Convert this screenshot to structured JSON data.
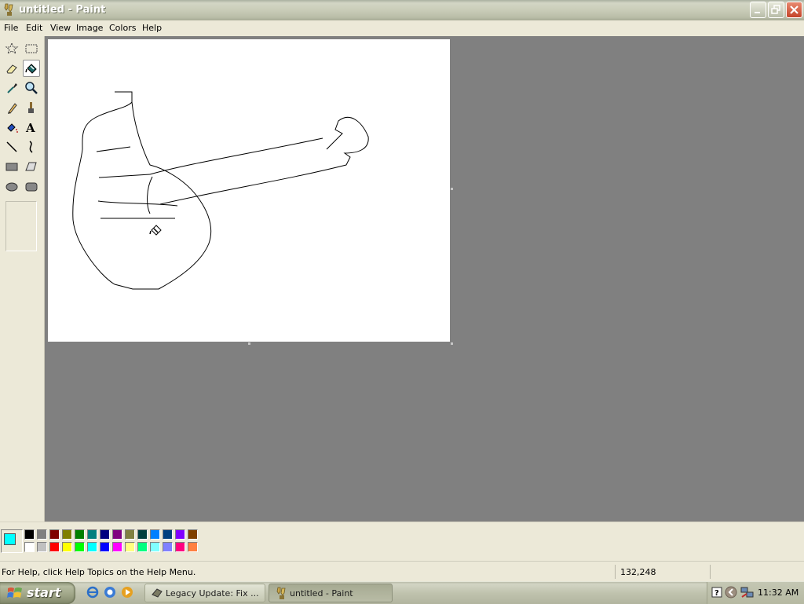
{
  "window": {
    "title": "untitled - Paint",
    "controls": [
      "minimize",
      "restore",
      "close"
    ]
  },
  "menu": [
    "File",
    "Edit",
    "View",
    "Image",
    "Colors",
    "Help"
  ],
  "tools": [
    {
      "name": "free-form-select",
      "icon": "star-select-icon"
    },
    {
      "name": "select",
      "icon": "rect-select-icon"
    },
    {
      "name": "eraser",
      "icon": "eraser-icon"
    },
    {
      "name": "fill-with-color",
      "icon": "paint-bucket-icon",
      "selected": true
    },
    {
      "name": "pick-color",
      "icon": "eyedropper-icon"
    },
    {
      "name": "magnifier",
      "icon": "magnifier-icon"
    },
    {
      "name": "pencil",
      "icon": "pencil-icon"
    },
    {
      "name": "brush",
      "icon": "brush-icon"
    },
    {
      "name": "airbrush",
      "icon": "airbrush-icon"
    },
    {
      "name": "text",
      "icon": "text-icon"
    },
    {
      "name": "line",
      "icon": "line-icon"
    },
    {
      "name": "curve",
      "icon": "curve-icon"
    },
    {
      "name": "rectangle",
      "icon": "rectangle-icon"
    },
    {
      "name": "polygon",
      "icon": "polygon-icon"
    },
    {
      "name": "ellipse",
      "icon": "ellipse-icon"
    },
    {
      "name": "rounded-rectangle",
      "icon": "rounded-rectangle-icon"
    }
  ],
  "palette": {
    "foreground": "#00ffff",
    "background": "#ffffff",
    "colors": [
      "#000000",
      "#808080",
      "#800000",
      "#808000",
      "#008000",
      "#008080",
      "#000080",
      "#800080",
      "#808040",
      "#004040",
      "#0080ff",
      "#004080",
      "#8000ff",
      "#804000",
      "#ffffff",
      "#c0c0c0",
      "#ff0000",
      "#ffff00",
      "#00ff00",
      "#00ffff",
      "#0000ff",
      "#ff00ff",
      "#ffff80",
      "#00ff80",
      "#80ffff",
      "#8080ff",
      "#ff0080",
      "#ff8040"
    ]
  },
  "status": {
    "help_text": "For Help, click Help Topics on the Help Menu.",
    "coordinates": "132,248"
  },
  "taskbar": {
    "start_label": "start",
    "quick_launch": [
      "internet-explorer-icon",
      "outlook-express-icon",
      "media-player-icon"
    ],
    "tasks": [
      {
        "label": "Legacy Update: Fix ...",
        "icon": "legacy-update-icon",
        "active": false
      },
      {
        "label": "untitled - Paint",
        "icon": "paint-icon",
        "active": true
      }
    ],
    "tray_icons": [
      "help-tray-icon",
      "expand-tray-icon",
      "network-tray-icon"
    ],
    "clock": "11:32 AM"
  }
}
